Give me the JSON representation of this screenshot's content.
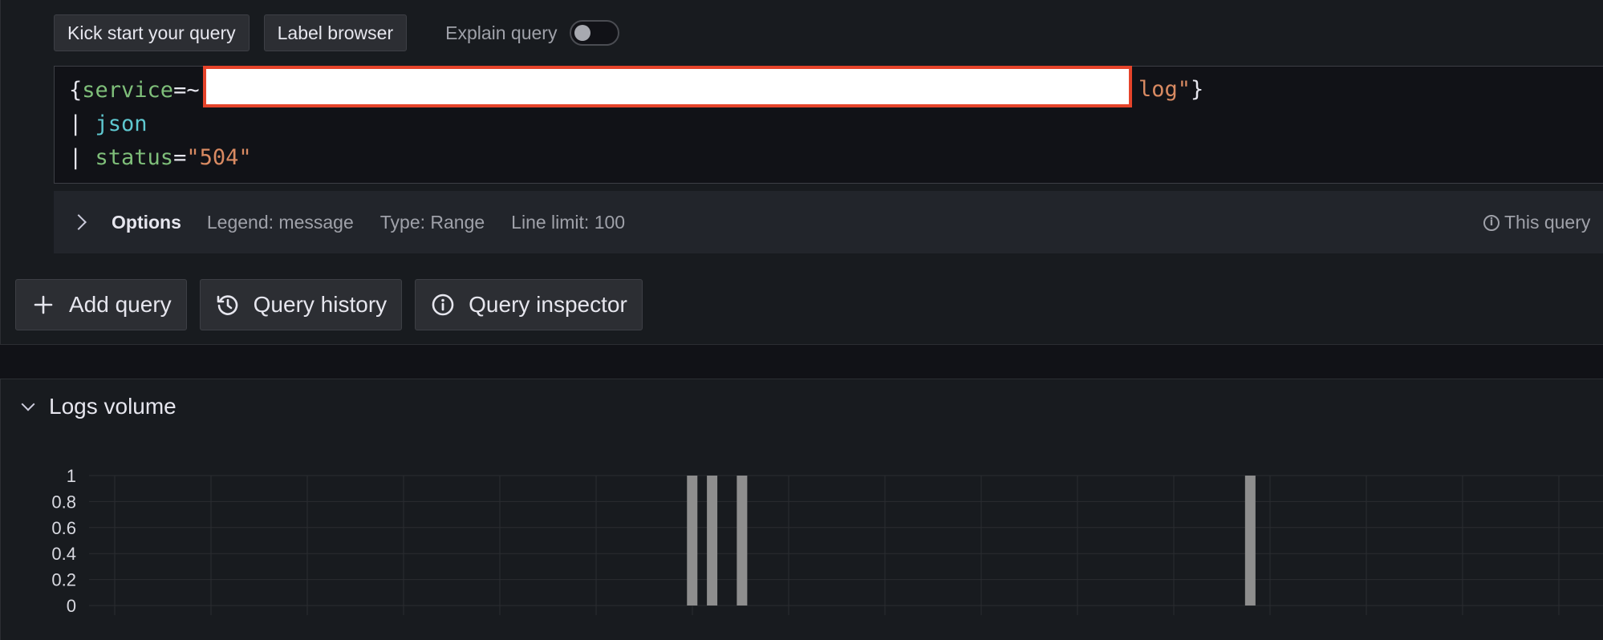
{
  "toolbar": {
    "kick_start_label": "Kick start your query",
    "label_browser_label": "Label browser",
    "explain_query_label": "Explain query",
    "explain_query_enabled": false
  },
  "editor": {
    "line1": {
      "open_brace": "{",
      "label": "service",
      "operator": "=~",
      "redacted": true,
      "tail": "log\"",
      "close_brace": "}"
    },
    "line2": {
      "pipe": "| ",
      "func": "json"
    },
    "line3": {
      "pipe": "| ",
      "label": "status",
      "operator": "=",
      "value": "\"504\""
    }
  },
  "options": {
    "label": "Options",
    "legend": "Legend: message",
    "type": "Type: Range",
    "line_limit": "Line limit: 100",
    "info_note": "This query"
  },
  "actions": {
    "add_query": "Add query",
    "query_history": "Query history",
    "query_inspector": "Query inspector"
  },
  "logs_volume": {
    "title": "Logs volume",
    "chart_data": {
      "type": "bar",
      "title": "",
      "xlabel": "",
      "ylabel": "",
      "ylim": [
        0,
        1
      ],
      "y_ticks": [
        "1",
        "0.8",
        "0.6",
        "0.4",
        "0.2",
        "0"
      ],
      "grid": true,
      "bar_color": "#8e8e8e",
      "x_bucket_count": 152,
      "series": [
        {
          "values_at_bucket": [
            {
              "bucket": 60,
              "value": 1
            },
            {
              "bucket": 62,
              "value": 1
            },
            {
              "bucket": 65,
              "value": 1
            },
            {
              "bucket": 116,
              "value": 1
            }
          ]
        }
      ]
    }
  }
}
